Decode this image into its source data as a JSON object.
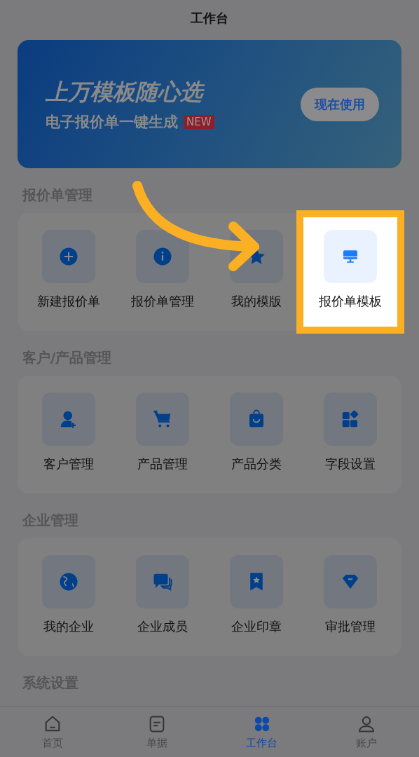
{
  "header": {
    "title": "工作台"
  },
  "banner": {
    "headline": "上万模板随心选",
    "subtitle": "电子报价单一键生成",
    "badge": "NEW",
    "button": "现在使用"
  },
  "sections": [
    {
      "title": "报价单管理",
      "items": [
        {
          "label": "新建报价单",
          "highlighted": false
        },
        {
          "label": "报价单管理",
          "highlighted": false
        },
        {
          "label": "我的模版",
          "highlighted": false
        },
        {
          "label": "报价单模板",
          "highlighted": true
        }
      ]
    },
    {
      "title": "客户/产品管理",
      "items": [
        {
          "label": "客户管理",
          "highlighted": false
        },
        {
          "label": "产品管理",
          "highlighted": false
        },
        {
          "label": "产品分类",
          "highlighted": false
        },
        {
          "label": "字段设置",
          "highlighted": false
        }
      ]
    },
    {
      "title": "企业管理",
      "items": [
        {
          "label": "我的企业",
          "highlighted": false
        },
        {
          "label": "企业成员",
          "highlighted": false
        },
        {
          "label": "企业印章",
          "highlighted": false
        },
        {
          "label": "审批管理",
          "highlighted": false
        }
      ]
    },
    {
      "title": "系统设置"
    }
  ],
  "tab_bar": [
    {
      "label": "首页",
      "selected": false
    },
    {
      "label": "单据",
      "selected": false
    },
    {
      "label": "工作台",
      "selected": true
    },
    {
      "label": "账户",
      "selected": false
    }
  ]
}
